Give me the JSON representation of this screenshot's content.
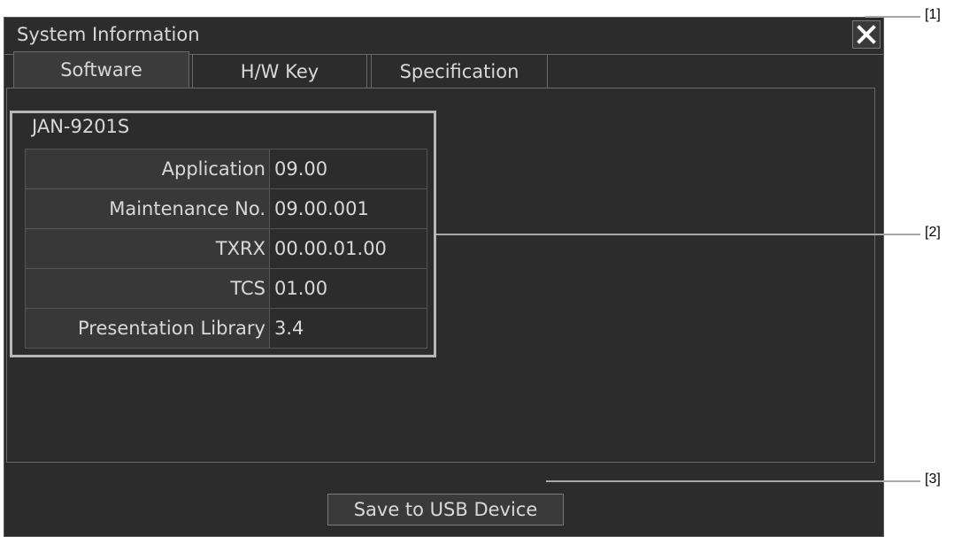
{
  "dialog": {
    "title": "System Information",
    "close_icon": "close-icon"
  },
  "tabs": [
    {
      "label": "Software",
      "active": true
    },
    {
      "label": "H/W Key",
      "active": false
    },
    {
      "label": "Specification",
      "active": false
    }
  ],
  "software": {
    "device_name": "JAN-9201S",
    "rows": [
      {
        "label": "Application",
        "value": "09.00"
      },
      {
        "label": "Maintenance No.",
        "value": "09.00.001"
      },
      {
        "label": "TXRX",
        "value": "00.00.01.00"
      },
      {
        "label": "TCS",
        "value": "01.00"
      },
      {
        "label": "Presentation Library",
        "value": "3.4"
      }
    ]
  },
  "footer": {
    "save_label": "Save to USB Device"
  },
  "callouts": [
    "[1]",
    "[2]",
    "[3]"
  ],
  "colors": {
    "dialog_bg": "#2c2c2c",
    "text": "#d8d8d8",
    "highlight": "#b8b8b8"
  }
}
